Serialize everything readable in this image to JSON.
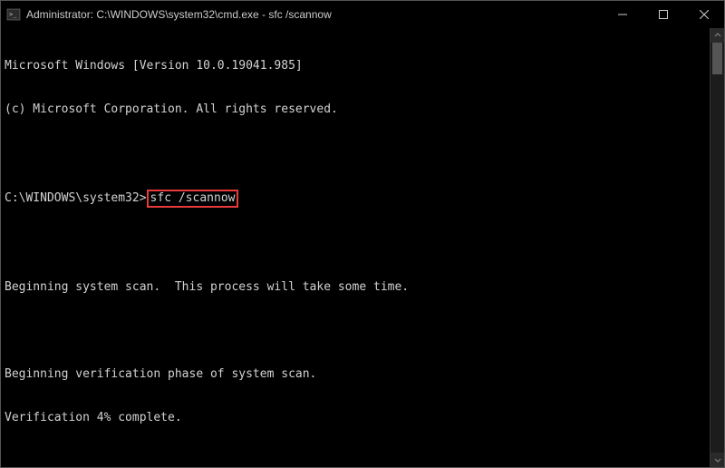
{
  "window": {
    "title": "Administrator: C:\\WINDOWS\\system32\\cmd.exe - sfc  /scannow"
  },
  "terminal": {
    "version_line": "Microsoft Windows [Version 10.0.19041.985]",
    "copyright_line": "(c) Microsoft Corporation. All rights reserved.",
    "prompt": "C:\\WINDOWS\\system32>",
    "command": "sfc /scannow",
    "scan_begin": "Beginning system scan.  This process will take some time.",
    "verification_begin": "Beginning verification phase of system scan.",
    "verification_progress": "Verification 4% complete."
  }
}
